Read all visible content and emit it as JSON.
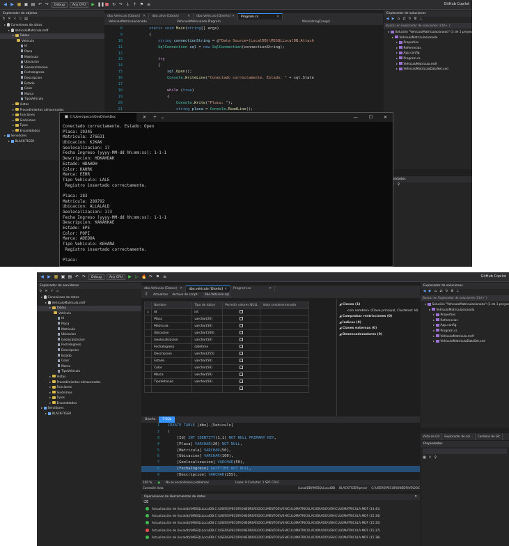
{
  "shot1": {
    "toolbar": {
      "config": "Debug",
      "platform": "Any CPU",
      "github": "GitHub Copilot"
    },
    "object_explorer": {
      "title": "Explorador de objetos",
      "items": [
        {
          "label": "Conexiones de datos",
          "icon": "plug-icon",
          "indent": 1
        },
        {
          "label": "VehiculoMatricula.mdf",
          "icon": "database-icon",
          "indent": 2
        },
        {
          "label": "Tablas",
          "icon": "folder-icon",
          "indent": 3
        },
        {
          "label": "Vehiculo",
          "icon": "table-icon",
          "indent": 4
        },
        {
          "label": "Id",
          "icon": "key-icon",
          "indent": 5
        },
        {
          "label": "Placa",
          "icon": "column-icon",
          "indent": 5
        },
        {
          "label": "Matricula",
          "icon": "column-icon",
          "indent": 5
        },
        {
          "label": "Ubicacion",
          "icon": "column-icon",
          "indent": 5
        },
        {
          "label": "Geolocalizacion",
          "icon": "column-icon",
          "indent": 5
        },
        {
          "label": "FechaIngreso",
          "icon": "column-icon",
          "indent": 5
        },
        {
          "label": "Descripcion",
          "icon": "column-icon",
          "indent": 5
        },
        {
          "label": "Estado",
          "icon": "column-icon",
          "indent": 5
        },
        {
          "label": "Color",
          "icon": "column-icon",
          "indent": 5
        },
        {
          "label": "Marca",
          "icon": "column-icon",
          "indent": 5
        },
        {
          "label": "TipoVehiculo",
          "icon": "column-icon",
          "indent": 5
        },
        {
          "label": "Vistas",
          "icon": "folder-icon",
          "indent": 3
        },
        {
          "label": "Procedimientos almacenados",
          "icon": "folder-icon",
          "indent": 3
        },
        {
          "label": "Funciones",
          "icon": "folder-icon",
          "indent": 3
        },
        {
          "label": "Sinónimos",
          "icon": "folder-icon",
          "indent": 3
        },
        {
          "label": "Tipos",
          "icon": "folder-icon",
          "indent": 3
        },
        {
          "label": "Ensamblados",
          "icon": "folder-icon",
          "indent": 3
        },
        {
          "label": "Servidores",
          "icon": "server-icon",
          "indent": 1
        },
        {
          "label": "BLACK-TIGER",
          "icon": "server-icon",
          "indent": 2
        }
      ]
    },
    "tabs": [
      {
        "label": "dbo.Vehiculo [Datos]",
        "active": false
      },
      {
        "label": "dbo.ulive [Datos]",
        "active": false
      },
      {
        "label": "dbo.Vehiculo [Diseño]",
        "active": false
      },
      {
        "label": "Program.cs",
        "active": true
      }
    ],
    "nav": {
      "left": "VehiculoMatriculacionado",
      "mid": "VehiculoMatriculado.Program",
      "right": "Main(string[] args)"
    },
    "code": [
      {
        "n": "8",
        "segs": [
          {
            "t": "        "
          },
          {
            "t": "static void ",
            "c": "kw"
          },
          {
            "t": "Main",
            "c": "me"
          },
          {
            "t": "(",
            "c": "pl"
          },
          {
            "t": "string",
            "c": "kw"
          },
          {
            "t": "[] args)",
            "c": "pl"
          }
        ]
      },
      {
        "n": "9",
        "segs": [
          {
            "t": "        {",
            "c": "pl"
          }
        ]
      },
      {
        "n": "10",
        "segs": [
          {
            "t": "            "
          },
          {
            "t": "string ",
            "c": "kw"
          },
          {
            "t": "connectionString ",
            "c": "va"
          },
          {
            "t": "= @",
            "c": "pl"
          },
          {
            "t": "\"Data Source=(LocalDB)\\MSSQLLocalDB;Attach",
            "c": "st"
          }
        ]
      },
      {
        "n": "11",
        "segs": [
          {
            "t": "            "
          },
          {
            "t": "SqlConnection ",
            "c": "ty"
          },
          {
            "t": "sql ",
            "c": "va"
          },
          {
            "t": "= ",
            "c": "pl"
          },
          {
            "t": "new ",
            "c": "kw"
          },
          {
            "t": "SqlConnection",
            "c": "ty"
          },
          {
            "t": "(connectionString);",
            "c": "pl"
          }
        ]
      },
      {
        "n": "12",
        "segs": []
      },
      {
        "n": "13",
        "segs": [
          {
            "t": "            "
          },
          {
            "t": "try",
            "c": "ctl"
          }
        ]
      },
      {
        "n": "14",
        "segs": [
          {
            "t": "            {",
            "c": "pl"
          }
        ]
      },
      {
        "n": "15",
        "segs": [
          {
            "t": "                "
          },
          {
            "t": "sql",
            "c": "va"
          },
          {
            "t": ".",
            "c": "pl"
          },
          {
            "t": "Open",
            "c": "me"
          },
          {
            "t": "();",
            "c": "pl"
          }
        ]
      },
      {
        "n": "16",
        "segs": [
          {
            "t": "                "
          },
          {
            "t": "Console",
            "c": "ty"
          },
          {
            "t": ".",
            "c": "pl"
          },
          {
            "t": "WriteLine",
            "c": "me"
          },
          {
            "t": "(",
            "c": "pl"
          },
          {
            "t": "\"Conectado correctamente. Estado: \"",
            "c": "st"
          },
          {
            "t": " + sql.State",
            "c": "pl"
          }
        ]
      },
      {
        "n": "17",
        "segs": []
      },
      {
        "n": "18",
        "segs": [
          {
            "t": "                "
          },
          {
            "t": "while ",
            "c": "ctl"
          },
          {
            "t": "(",
            "c": "pl"
          },
          {
            "t": "true",
            "c": "kw"
          },
          {
            "t": ")",
            "c": "pl"
          }
        ]
      },
      {
        "n": "19",
        "segs": [
          {
            "t": "                {",
            "c": "pl"
          }
        ]
      },
      {
        "n": "20",
        "segs": [
          {
            "t": "                    "
          },
          {
            "t": "Console",
            "c": "ty"
          },
          {
            "t": ".",
            "c": "pl"
          },
          {
            "t": "Write",
            "c": "me"
          },
          {
            "t": "(",
            "c": "pl"
          },
          {
            "t": "\"Placa: \"",
            "c": "st"
          },
          {
            "t": ");",
            "c": "pl"
          }
        ]
      },
      {
        "n": "21",
        "segs": [
          {
            "t": "                    "
          },
          {
            "t": "string ",
            "c": "kw"
          },
          {
            "t": "placa ",
            "c": "va"
          },
          {
            "t": "= ",
            "c": "pl"
          },
          {
            "t": "Console",
            "c": "ty"
          },
          {
            "t": ".",
            "c": "pl"
          },
          {
            "t": "ReadLine",
            "c": "me"
          },
          {
            "t": "();",
            "c": "pl"
          }
        ]
      }
    ],
    "console": {
      "title": "C:\\Users\\pecor\\OneDrive\\Doc",
      "lines": [
        "Conectado correctamente. Estado: Open",
        "Placa: 19345",
        "Matricula: 276631",
        "Ubicacion: KJKAK",
        "Geolocalizacion: 17",
        "Fecha Ingreso (yyyy-MM-dd hh:mm:ss): 1-1-1",
        "Descripcion: HDKAHDAK",
        "Estado: HDAHDH",
        "Color: KAHRK",
        "Marca: EERR",
        "Tipo Vehiculo: LALE",
        " Registro insertado correctamente.",
        "",
        "Placa: 283",
        "Matricula: 289792",
        "Ubicacion: ALLALALD",
        "Geolocalizacion: 173",
        "Fecha Ingreso (yyyy-MM-dd hh:mm:ss): 1-1-1",
        "Descripcion: KAKAKKAE",
        "Estado: EPE",
        "Color: POPI",
        "Marca: ADEDOA",
        "Tipo Vehiculo: KEHANA",
        " Registro insertado correctamente.",
        "",
        "Placa:"
      ]
    },
    "solution_explorer": {
      "title": "Explorador de soluciones",
      "search": "Buscar en Explorador de soluciones (Ctrl+`)",
      "items": [
        {
          "label": "Solución \"VehiculoMatriculacionado\" (1 de 1 proyecto)",
          "indent": 1
        },
        {
          "label": "VehiculoMatriculacionado",
          "indent": 2
        },
        {
          "label": "Properties",
          "indent": 3
        },
        {
          "label": "Referencias",
          "indent": 3
        },
        {
          "label": "App.config",
          "indent": 3
        },
        {
          "label": "Program.cs",
          "indent": 3
        },
        {
          "label": "VehiculoMatricula.mdf",
          "indent": 3
        },
        {
          "label": "VehiculoMatriculaDataSet.xsd",
          "indent": 3
        }
      ],
      "bottom_tabs": [
        "Vista de Git",
        "Explorador de solu...",
        "Cambios de Git"
      ],
      "props_title": "Propiedades"
    }
  },
  "shot2": {
    "toolbar": {
      "config": "Debug",
      "platform": "Any CPU",
      "github": "GitHub Copilot"
    },
    "object_explorer": {
      "title": "Explorador de servidores",
      "items": [
        {
          "label": "Conexiones de datos",
          "indent": 1
        },
        {
          "label": "VehiculoMatricula.mdf",
          "indent": 2
        },
        {
          "label": "Tablas",
          "indent": 3
        },
        {
          "label": "Vehiculo",
          "indent": 4
        },
        {
          "label": "Id",
          "indent": 5
        },
        {
          "label": "Placa",
          "indent": 5
        },
        {
          "label": "Matricula",
          "indent": 5
        },
        {
          "label": "Ubicacion",
          "indent": 5
        },
        {
          "label": "Geolocalizacion",
          "indent": 5
        },
        {
          "label": "FechaIngreso",
          "indent": 5
        },
        {
          "label": "Descripcion",
          "indent": 5
        },
        {
          "label": "Estado",
          "indent": 5
        },
        {
          "label": "Color",
          "indent": 5
        },
        {
          "label": "Marca",
          "indent": 5
        },
        {
          "label": "TipoVehiculo",
          "indent": 5
        },
        {
          "label": "Vistas",
          "indent": 3
        },
        {
          "label": "Procedimientos almacenados",
          "indent": 3
        },
        {
          "label": "Funciones",
          "indent": 3
        },
        {
          "label": "Sinónimos",
          "indent": 3
        },
        {
          "label": "Tipos",
          "indent": 3
        },
        {
          "label": "Ensamblados",
          "indent": 3
        },
        {
          "label": "Servidores",
          "indent": 1
        },
        {
          "label": "BLACK-TIGER",
          "indent": 2
        }
      ]
    },
    "tabs": [
      {
        "label": "dbo.Vehiculo [Datos]",
        "active": false
      },
      {
        "label": "dbo.vehiculo [Diseño]",
        "active": true
      },
      {
        "label": "Program.cs",
        "active": false
      }
    ],
    "design_toolbar": {
      "update": "Actualizar",
      "script": "Archivo de script:",
      "file": "dbo.Vehiculo.sql"
    },
    "grid": {
      "headers": [
        "Nombre",
        "Tipo de datos",
        "Permitir valores NULL",
        "Valor predeterminado"
      ],
      "rows": [
        {
          "name": "Id",
          "type": "int",
          "nullable": false,
          "key": true
        },
        {
          "name": "Placa",
          "type": "varchar(20)",
          "nullable": false
        },
        {
          "name": "Matricula",
          "type": "varchar(50)",
          "nullable": false
        },
        {
          "name": "Ubicacion",
          "type": "varchar(100)",
          "nullable": false
        },
        {
          "name": "Geolocalizacion",
          "type": "varchar(50)",
          "nullable": false
        },
        {
          "name": "FechaIngreso",
          "type": "datetime",
          "nullable": false
        },
        {
          "name": "Descripcion",
          "type": "varchar(255)",
          "nullable": false
        },
        {
          "name": "Estado",
          "type": "varchar(50)",
          "nullable": false
        },
        {
          "name": "Color",
          "type": "varchar(50)",
          "nullable": false
        },
        {
          "name": "Marca",
          "type": "varchar(50)",
          "nullable": false
        },
        {
          "name": "TipoVehiculo",
          "type": "varchar(50)",
          "nullable": false
        },
        {
          "name": "",
          "type": "",
          "nullable": false
        }
      ]
    },
    "keys_panel": [
      {
        "label": "Claves (1)",
        "bold": true
      },
      {
        "label": "<sin nombre>   (Clave principal, Clustered: Id)",
        "bold": false
      },
      {
        "label": "Comprobar restricciones (0)",
        "bold": true
      },
      {
        "label": "Índices (0)",
        "bold": true
      },
      {
        "label": "Claves externas (0)",
        "bold": true
      },
      {
        "label": "Desencadenadores (0)",
        "bold": true
      }
    ],
    "sql_tabs": [
      "Diseño",
      "T-SQL"
    ],
    "sql": [
      {
        "n": "1",
        "segs": [
          {
            "t": "CREATE TABLE ",
            "c": "kw"
          },
          {
            "t": "[dbo]",
            "c": "pl"
          },
          {
            "t": ".",
            "c": "pl"
          },
          {
            "t": "[Vehiculo]",
            "c": "pl"
          }
        ]
      },
      {
        "n": "2",
        "segs": [
          {
            "t": "(",
            "c": "pl"
          }
        ]
      },
      {
        "n": "3",
        "segs": [
          {
            "t": "    [Id] ",
            "c": "pl"
          },
          {
            "t": "INT IDENTITY",
            "c": "kw"
          },
          {
            "t": "(1,1) ",
            "c": "pl"
          },
          {
            "t": "NOT NULL PRIMARY KEY",
            "c": "kw"
          },
          {
            "t": ",",
            "c": "pl"
          }
        ]
      },
      {
        "n": "4",
        "segs": [
          {
            "t": "    [Placa] ",
            "c": "pl"
          },
          {
            "t": "VARCHAR",
            "c": "kw"
          },
          {
            "t": "(20) ",
            "c": "pl"
          },
          {
            "t": "NOT NULL",
            "c": "kw"
          },
          {
            "t": ",",
            "c": "pl"
          }
        ]
      },
      {
        "n": "5",
        "segs": [
          {
            "t": "    [Matricula] ",
            "c": "pl"
          },
          {
            "t": "VARCHAR",
            "c": "kw"
          },
          {
            "t": "(50),",
            "c": "pl"
          }
        ]
      },
      {
        "n": "6",
        "segs": [
          {
            "t": "    [Ubicacion] ",
            "c": "pl"
          },
          {
            "t": "VARCHAR",
            "c": "kw"
          },
          {
            "t": "(100),",
            "c": "pl"
          }
        ]
      },
      {
        "n": "7",
        "segs": [
          {
            "t": "    [Geolocalizacion] ",
            "c": "pl"
          },
          {
            "t": "VARCHAR",
            "c": "kw"
          },
          {
            "t": "(50),",
            "c": "pl"
          }
        ]
      },
      {
        "n": "8",
        "segs": [
          {
            "t": "    [FechaIngreso] ",
            "c": "pl"
          },
          {
            "t": "DATETIME NOT NULL",
            "c": "kw"
          },
          {
            "t": ",",
            "c": "pl"
          }
        ],
        "hl": true
      },
      {
        "n": "9",
        "segs": [
          {
            "t": "    [Descripcion] ",
            "c": "pl"
          },
          {
            "t": "VARCHAR",
            "c": "kw"
          },
          {
            "t": "(255),",
            "c": "pl"
          }
        ]
      }
    ],
    "status": {
      "zoom": "100 %",
      "issues": "No se encontraron problemas",
      "pos": "Línea: 9   Carácter: 1   SPC   CRLF",
      "conn": "Conexión lista",
      "db": "(LocalDB)\\MSSQLLocalDB",
      "user": "BLACK-TIGER\\pecor",
      "path": "C:\\USERS\\PECOR\\ONEDRIVE\\DOC"
    },
    "output": {
      "title": "Operaciones de Herramientas de datos",
      "rows": [
        {
          "ok": true,
          "text": "Actualización de (localdb)\\MSSQLLocalDB.C:\\USERS\\PECOR\\ONEDRIVE\\DOCUMENTOS\\VEHICULOMATRICULACIONADO\\VEHICULOMATRICULA.MDF (14:41)"
        },
        {
          "ok": true,
          "text": "Actualización de (localdb)\\MSSQLLocalDB.C:\\USERS\\PECOR\\ONEDRIVE\\DOCUMENTOS\\VEHICULOMATRICULACIONADO\\VEHICULOMATRICULA.MDF (15:34)"
        },
        {
          "ok": true,
          "text": "Actualización de (localdb)\\MSSQLLocalDB.C:\\USERS\\PECOR\\ONEDRIVE\\DOCUMENTOS\\VEHICULOMATRICULACIONADO\\VEHICULOMATRICULA.MDF (15:35)"
        },
        {
          "ok": false,
          "text": "Actualización de (localdb)\\MSSQLLocalDB.C:\\USERS\\PECOR\\ONEDRIVE\\DOCUMENTOS\\VEHICULOMATRICULACIONADO\\VEHICULOMATRICULA.MDF (15:37)"
        },
        {
          "ok": true,
          "text": "Actualización de (localdb)\\MSSQLLocalDB.C:\\USERS\\PECOR\\ONEDRIVE\\DOCUMENTOS\\VEHICULOMATRICULACIONADO\\VEHICULOMATRICULA.MDF (15:38)"
        }
      ]
    },
    "solution_explorer": {
      "title": "Explorador de soluciones",
      "search": "Buscar en Explorador de soluciones (Ctrl+`)",
      "items": [
        {
          "label": "Solución \"VehiculoMatriculacionado\" (1 de 1 proyecto)",
          "indent": 1
        },
        {
          "label": "VehiculoMatriculacionado",
          "indent": 2
        },
        {
          "label": "Properties",
          "indent": 3
        },
        {
          "label": "Referencias",
          "indent": 3
        },
        {
          "label": "App.config",
          "indent": 3
        },
        {
          "label": "Program.cs",
          "indent": 3
        },
        {
          "label": "VehiculoMatricula.mdf",
          "indent": 3
        },
        {
          "label": "VehiculoMatriculaDataSet.xsd",
          "indent": 3
        }
      ],
      "bottom_tabs": [
        "Vista de Git",
        "Explorador de sol...",
        "Cambios de Git"
      ],
      "props_title": "Propiedades"
    }
  }
}
